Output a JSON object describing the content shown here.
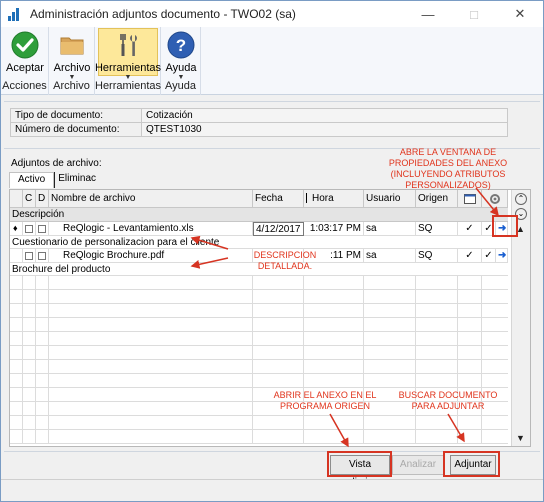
{
  "window": {
    "title": "Administración adjuntos documento  -  TWO02 (sa)",
    "controls": [
      "minimize-icon",
      "maximize-icon",
      "close-icon"
    ]
  },
  "ribbon": {
    "groups": [
      {
        "label": "Acciones",
        "buttons": [
          {
            "label": "Aceptar",
            "icon": "check-icon"
          }
        ]
      },
      {
        "label": "Archivo",
        "buttons": [
          {
            "label": "Archivo",
            "icon": "folder-icon"
          }
        ]
      },
      {
        "label": "Herramientas",
        "buttons": [
          {
            "label": "Herramientas",
            "icon": "tools-icon"
          }
        ]
      },
      {
        "label": "Ayuda",
        "buttons": [
          {
            "label": "Ayuda",
            "icon": "help-icon"
          }
        ]
      }
    ]
  },
  "document": {
    "type_label": "Tipo de documento:",
    "type_value": "Cotización",
    "number_label": "Número de documento:",
    "number_value": "QTEST1030"
  },
  "attachments": {
    "label": "Adjuntos de archivo:",
    "tabs": [
      "Activo",
      "Eliminac"
    ],
    "columns": {
      "c": "C",
      "d": "D",
      "filename": "Nombre de archivo",
      "date": "Fecha",
      "time": "Hora",
      "user": "Usuario",
      "origin": "Origen"
    },
    "description_header": "Descripción",
    "rows": [
      {
        "marker": "♦",
        "filename": "ReQlogic - Levantamiento.xls",
        "date": "4/12/2017",
        "time": "1:03:17 PM",
        "user": "sa",
        "origin": "SQ",
        "check1": "✓",
        "check2": "✓",
        "description": "Cuestionario de personalizacion para el cliente"
      },
      {
        "marker": "",
        "filename": "ReQlogic Brochure.pdf",
        "date": "",
        "time": ":11 PM",
        "user": "sa",
        "origin": "SQ",
        "check1": "✓",
        "check2": "✓",
        "description": "Brochure del producto"
      }
    ]
  },
  "buttons": {
    "preview": "Vista preliminar",
    "analyze": "Analizar",
    "attach": "Adjuntar"
  },
  "annotations": {
    "properties": "ABRE LA VENTANA DE\nPROPIEDADES DEL ANEXO\n(INCLUYENDO ATRIBUTOS PERSONALIZADOS)",
    "description": "DESCRIPCION DETALLADA.",
    "open_origin": "ABRIR EL ANEXO EN EL\nPROGRAMA ORIGEN",
    "search": "BUSCAR DOCUMENTO\nPARA ADJUNTAR"
  },
  "colors": {
    "annotation": "#e0341c",
    "ribbon_highlight": "#fde89a",
    "accept": "#2e9e3a",
    "help": "#2f5fb3",
    "link_arrow": "#1a5fd0"
  }
}
